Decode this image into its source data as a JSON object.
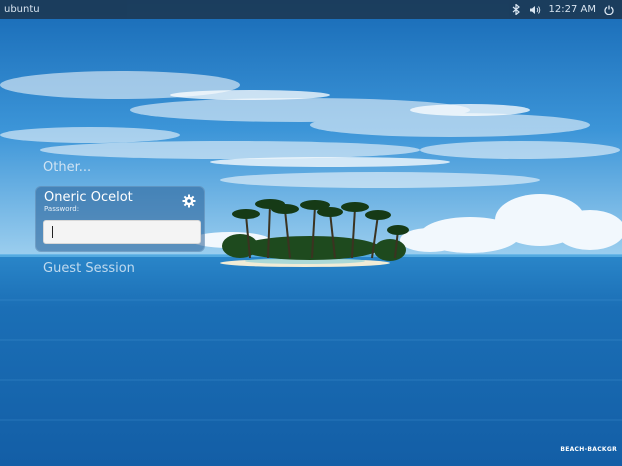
{
  "topbar": {
    "left_label": "ubuntu",
    "clock": "12:27 AM",
    "icons": [
      "bluetooth-icon",
      "volume-icon",
      "power-icon"
    ]
  },
  "greeter": {
    "other_label": "Other...",
    "user_name": "Oneric Ocelot",
    "password_label": "Password:",
    "password_value": "",
    "guest_label": "Guest Session",
    "session_icon": "gear-icon"
  },
  "wallpaper": {
    "watermark": "BEACH-BACKGR"
  }
}
